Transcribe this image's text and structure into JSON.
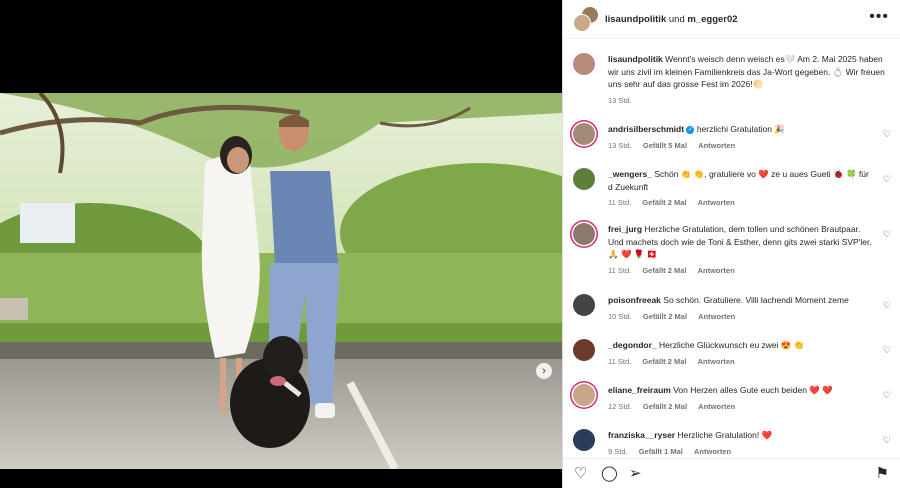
{
  "header": {
    "user1": "lisaundpolitik",
    "separator": " und ",
    "user2": "m_egger02",
    "more": "•••"
  },
  "caption": {
    "username": "lisaundpolitik",
    "text": "Wennt's weisch denn weisch es🤍 Am 2. Mai 2025 haben wir uns zivil im kleinen Familienkreis das Ja-Wort gegeben. 💍 Wir freuen uns sehr auf das grosse Fest im 2026!🌕",
    "time": "13 Std."
  },
  "comments": [
    {
      "username": "andrisilberschmidt",
      "verified": "✓",
      "text": "herzlichi Gratulation 🎉",
      "time": "13 Std.",
      "likes": "Gefällt 5 Mal",
      "reply": "Antworten",
      "color": "#a28a74"
    },
    {
      "username": "_wengers_",
      "text": "Schön 👏 👏, gratuliere vo ❤️ ze u aues Gueti 🐞 🍀 für d Zuekunft",
      "time": "11 Std.",
      "likes": "Gefällt 2 Mal",
      "reply": "Antworten",
      "color": "#5a7f3a"
    },
    {
      "username": "frei_jurg",
      "text": "Herzliche Gratulation, dem tollen und schönen Brautpaar. Und machets doch wie de Toni & Esther, denn gits zwei starki SVP'ler. 🙏 ❤️ 🌹 🇨🇭",
      "time": "11 Std.",
      "likes": "Gefällt 2 Mal",
      "reply": "Antworten",
      "color": "#8a7a6a"
    },
    {
      "username": "poisonfreeak",
      "text": "So schön. Gratuliere. Villi lachendi Moment zeme",
      "time": "10 Std.",
      "likes": "Gefällt 2 Mal",
      "reply": "Antworten",
      "color": "#444444"
    },
    {
      "username": "_degondor_",
      "text": "Herzliche Glückwunsch eu zwei 😍 👏",
      "time": "11 Std.",
      "likes": "Gefällt 2 Mal",
      "reply": "Antworten",
      "color": "#6b3a2a"
    },
    {
      "username": "eliane_freiraum",
      "text": "Von Herzen alles Gute euch beiden ❤️ ❤️",
      "time": "12 Std.",
      "likes": "Gefällt 2 Mal",
      "reply": "Antworten",
      "color": "#c9a58a"
    },
    {
      "username": "franziska__ryser",
      "text": "Herzliche Gratulation! ❤️",
      "time": "9 Std.",
      "likes": "Gefällt 1 Mal",
      "reply": "Antworten",
      "color": "#2b3d5a"
    }
  ],
  "icons": {
    "like": "♡",
    "comment": "◯",
    "share": "➢",
    "save": "⚑",
    "next": "›"
  }
}
